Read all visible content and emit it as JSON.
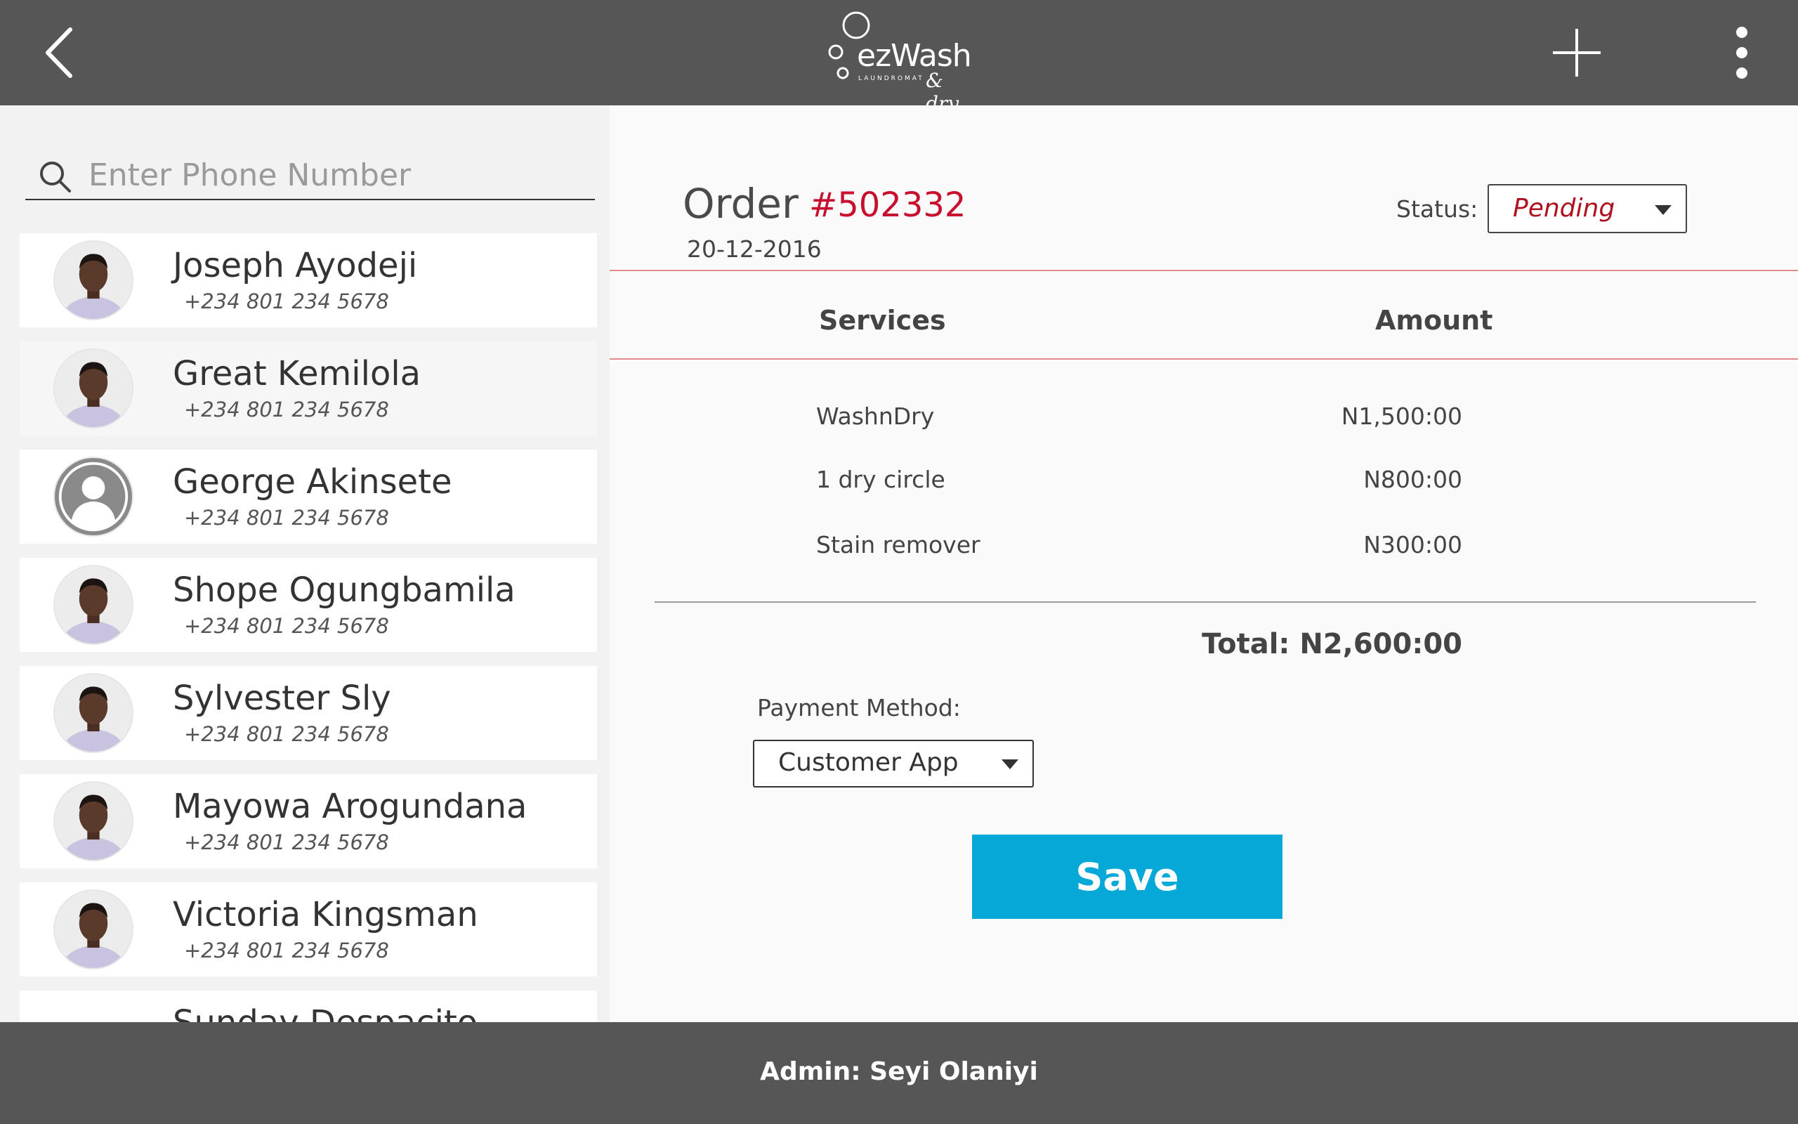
{
  "header": {
    "logo_text": "ezWash",
    "logo_sub": "LAUNDROMAT",
    "logo_script": "& dry"
  },
  "search": {
    "placeholder": "Enter Phone Number",
    "value": ""
  },
  "contacts": [
    {
      "name": "Joseph Ayodeji",
      "phone": "+234 801 234 5678",
      "avatar": "photo"
    },
    {
      "name": "Great Kemilola",
      "phone": "+234 801 234 5678",
      "avatar": "photo"
    },
    {
      "name": "George Akinsete",
      "phone": "+234 801 234 5678",
      "avatar": "placeholder"
    },
    {
      "name": "Shope Ogungbamila",
      "phone": "+234 801 234 5678",
      "avatar": "photo"
    },
    {
      "name": "Sylvester Sly",
      "phone": "+234 801 234 5678",
      "avatar": "photo"
    },
    {
      "name": "Mayowa Arogundana",
      "phone": "+234 801 234 5678",
      "avatar": "photo"
    },
    {
      "name": "Victoria Kingsman",
      "phone": "+234 801 234 5678",
      "avatar": "photo"
    },
    {
      "name": "Sunday Despacito",
      "phone": "",
      "avatar": "none"
    }
  ],
  "order": {
    "label": "Order",
    "number": "#502332",
    "date": "20-12-2016",
    "status_label": "Status:",
    "status_value": "Pending",
    "columns": {
      "services": "Services",
      "amount": "Amount"
    },
    "services": [
      {
        "name": "WashnDry",
        "amount": "N1,500:00"
      },
      {
        "name": "1 dry circle",
        "amount": "N800:00"
      },
      {
        "name": "Stain remover",
        "amount": "N300:00"
      }
    ],
    "total": "Total: N2,600:00",
    "payment_label": "Payment Method:",
    "payment_value": "Customer App",
    "save_label": "Save"
  },
  "footer": {
    "admin": "Admin: Seyi Olaniyi"
  },
  "colors": {
    "bar": "#565656",
    "accent_red": "#c8102e",
    "save_blue": "#06a8d8"
  }
}
